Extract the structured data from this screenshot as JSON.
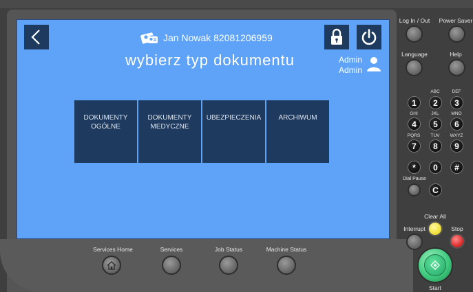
{
  "screen": {
    "user_name": "Jan Nowak 82081206959",
    "title": "wybierz typ dokumentu",
    "admin_line1": "Admin",
    "admin_line2": "Admin",
    "tiles": [
      "DOKUMENTY\nOGÓLNE",
      "DOKUMENTY\nMEDYCZNE",
      "UBEZPIECZENIA",
      "ARCHIWUM"
    ]
  },
  "bottom": {
    "services_home": "Services Home",
    "services": "Services",
    "job_status": "Job Status",
    "machine_status": "Machine Status"
  },
  "side": {
    "log_in_out": "Log In / Out",
    "power_saver": "Power Saver",
    "language": "Language",
    "help": "Help",
    "dial_pause": "Dial Pause",
    "clear_all": "Clear All",
    "interrupt": "Interrupt",
    "stop": "Stop",
    "start": "Start"
  },
  "keypad": {
    "letters": [
      "ABC",
      "DEF",
      "GHI",
      "JKL",
      "MNO",
      "PQRS",
      "TUV",
      "WXYZ"
    ],
    "keys": [
      "1",
      "2",
      "3",
      "4",
      "5",
      "6",
      "7",
      "8",
      "9",
      "*",
      "0",
      "#",
      "C"
    ]
  },
  "colors": {
    "screen_bg": "#5ea3f7",
    "tile_bg": "#1f3a5f",
    "device_body": "#3f3f3f",
    "clear_all": "#f2e23e",
    "stop": "#e03030",
    "start": "#3fca7e"
  },
  "icons": {
    "back": "chevron-left-icon",
    "lock": "lock-icon",
    "power": "power-icon",
    "user_id": "id-card-icon",
    "admin": "person-icon",
    "home": "home-icon",
    "start": "diamond-start-icon"
  }
}
